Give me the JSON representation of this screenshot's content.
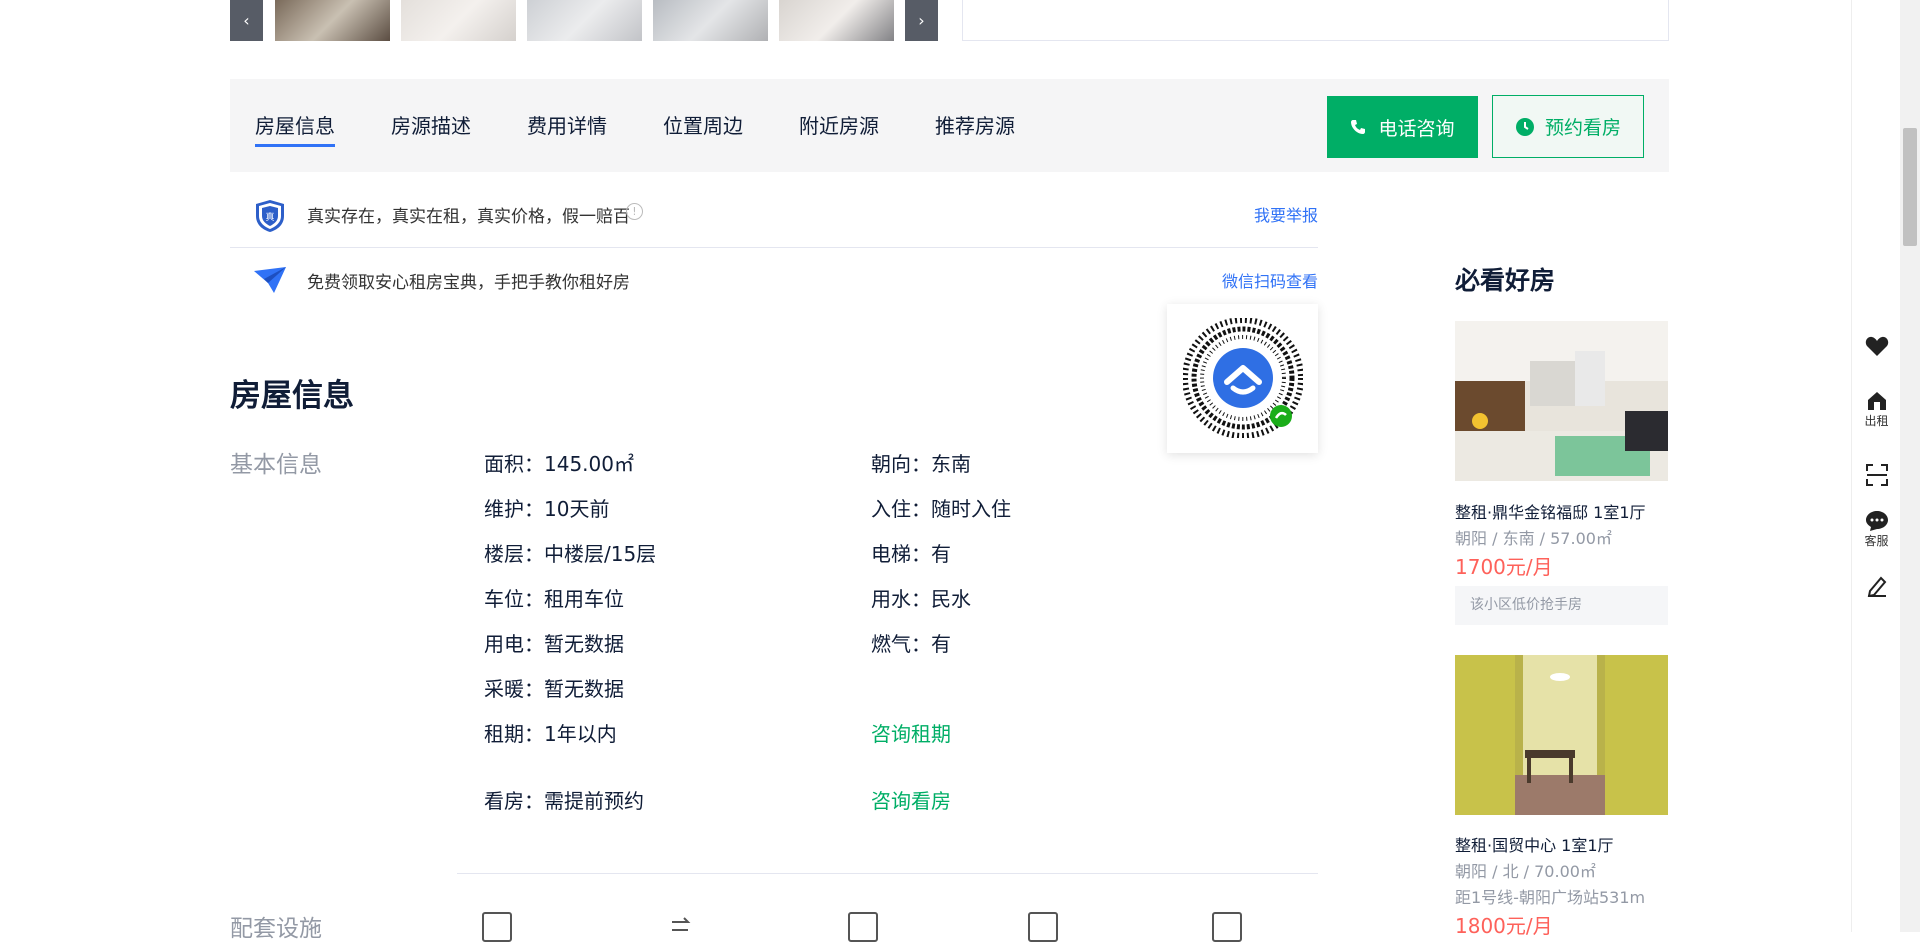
{
  "tabs": [
    "房屋信息",
    "房源描述",
    "费用详情",
    "位置周边",
    "附近房源",
    "推荐房源"
  ],
  "actions": {
    "call": "电话咨询",
    "visit": "预约看房"
  },
  "notices": {
    "guarantee": "真实存在，真实在租，真实价格，假一赔百",
    "guarantee_badge": "真",
    "report": "我要举报",
    "guide": "免费领取安心租房宝典，手把手教你租好房",
    "wechat": "微信扫码查看"
  },
  "info": {
    "title": "房屋信息",
    "basic_label": "基本信息",
    "rows": {
      "area": "面积：145.00㎡",
      "orientation": "朝向：东南",
      "maintain": "维护：10天前",
      "movein": "入住：随时入住",
      "floor": "楼层：中楼层/15层",
      "elevator": "电梯：有",
      "parking": "车位：租用车位",
      "water": "用水：民水",
      "electric": "用电：暂无数据",
      "gas": "燃气：有",
      "heating": "采暖：暂无数据",
      "lease": "租期：1年以内",
      "lease_consult": "咨询租期",
      "viewing": "看房：需提前预约",
      "viewing_consult": "咨询看房"
    },
    "facilities_label": "配套设施"
  },
  "recommend": {
    "title": "必看好房",
    "cards": [
      {
        "title": "整租·鼎华金铭福邸 1室1厅",
        "meta": "朝阳 / 东南 / 57.00㎡",
        "price": "1700元/月",
        "tag": "该小区低价抢手房"
      },
      {
        "title": "整租·国贸中心 1室1厅",
        "meta": "朝阳 / 北 / 70.00㎡",
        "meta2": "距1号线-朝阳广场站531m",
        "price": "1800元/月"
      }
    ]
  },
  "sidebar": {
    "rent": "出租",
    "service": "客服"
  }
}
